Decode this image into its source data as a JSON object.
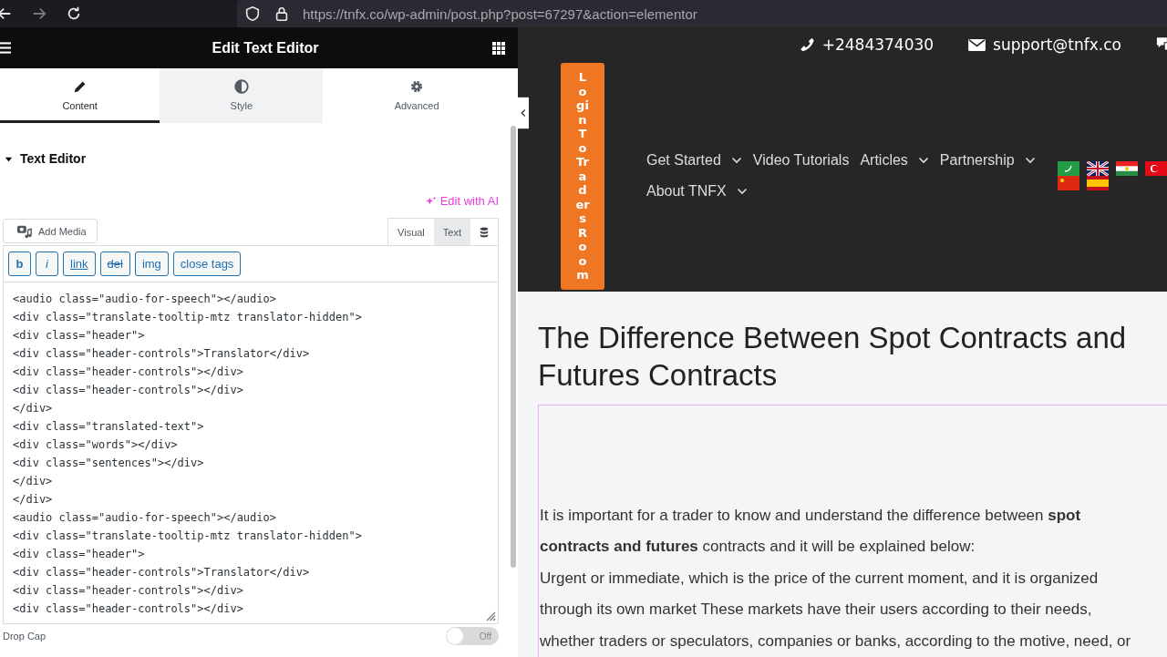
{
  "browser": {
    "url": "https://tnfx.co/wp-admin/post.php?post=67297&action=elementor"
  },
  "panel": {
    "title": "Edit Text Editor",
    "tabs": [
      {
        "label": "Content",
        "selected": true
      },
      {
        "label": "Style",
        "selected": false
      },
      {
        "label": "Advanced",
        "selected": false
      }
    ],
    "section": {
      "title": "Text Editor",
      "expanded": true
    },
    "edit_ai": "Edit with AI",
    "add_media": "Add Media",
    "editor_modes": [
      {
        "label": "Visual",
        "selected": false
      },
      {
        "label": "Text",
        "selected": true
      }
    ],
    "quicktags": [
      {
        "label": "b",
        "kind": "bold"
      },
      {
        "label": "i",
        "kind": "italic"
      },
      {
        "label": "link",
        "kind": "link"
      },
      {
        "label": "del",
        "kind": "strike"
      },
      {
        "label": "img",
        "kind": "plain"
      },
      {
        "label": "close tags",
        "kind": "plain"
      }
    ],
    "code_lines": [
      "<audio class=\"audio-for-speech\"></audio>",
      "<div class=\"translate-tooltip-mtz translator-hidden\">",
      "<div class=\"header\">",
      "<div class=\"header-controls\">Translator</div>",
      "<div class=\"header-controls\"></div>",
      "<div class=\"header-controls\"></div>",
      "</div>",
      "<div class=\"translated-text\">",
      "<div class=\"words\"></div>",
      "<div class=\"sentences\"></div>",
      "</div>",
      "</div>",
      "<audio class=\"audio-for-speech\"></audio>",
      "<div class=\"translate-tooltip-mtz translator-hidden\">",
      "<div class=\"header\">",
      "<div class=\"header-controls\">Translator</div>",
      "<div class=\"header-controls\"></div>",
      "<div class=\"header-controls\"></div>"
    ],
    "drop_cap": {
      "label": "Drop Cap",
      "toggle": "Off",
      "on": false
    }
  },
  "site": {
    "phone": "+2484374030",
    "email": "support@tnfx.co",
    "login_button": "Login To Traders Room",
    "nav": [
      {
        "label": "Get Started",
        "dropdown": true
      },
      {
        "label": "Video Tutorials",
        "dropdown": false
      },
      {
        "label": "Articles",
        "dropdown": true
      },
      {
        "label": "Partnership",
        "dropdown": true
      },
      {
        "label": "About TNFX",
        "dropdown": true
      }
    ],
    "heading": "The Difference Between Spot Contracts and Futures Contracts",
    "paragraphs": [
      "It is important for a trader to know and understand the difference between **spot contracts and futures** contracts and it will be explained below:",
      "Urgent or immediate, which is the price of the current moment, and it is organized through its own market These markets have their users according to their needs, whether traders or speculators, companies or banks, according to the motive, need, or"
    ]
  }
}
